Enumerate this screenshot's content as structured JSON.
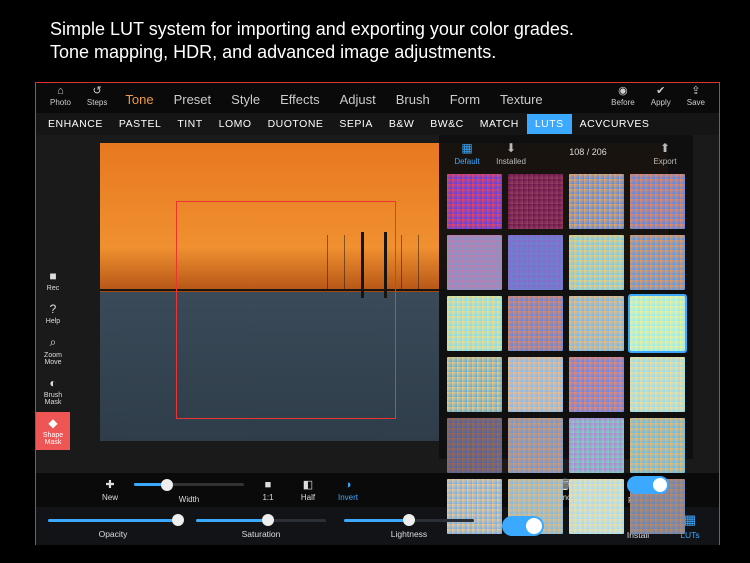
{
  "promo": {
    "line1": "Simple LUT system for importing and exporting your color grades.",
    "line2": "Tone mapping, HDR, and advanced image adjustments."
  },
  "menubar": {
    "photo": "Photo",
    "steps": "Steps",
    "tabs": [
      "Tone",
      "Preset",
      "Style",
      "Effects",
      "Adjust",
      "Brush",
      "Form",
      "Texture"
    ],
    "active_tab": "Tone",
    "before": "Before",
    "apply": "Apply",
    "save": "Save"
  },
  "subtabs": {
    "items": [
      "ENHANCE",
      "PASTEL",
      "TINT",
      "LOMO",
      "DUOTONE",
      "SEPIA",
      "B&W",
      "BW&C",
      "MATCH",
      "LUTS",
      "ACVCURVES"
    ],
    "active": "LUTS"
  },
  "side_tools": [
    {
      "icon": "●",
      "label": "Rec"
    },
    {
      "icon": "?",
      "label": "Help"
    },
    {
      "icon": "⌕",
      "label": "Zoom\nMove"
    },
    {
      "icon": "◐",
      "label": "Brush\nMask"
    },
    {
      "icon": "◆",
      "label": "Shape\nMask",
      "active": true
    }
  ],
  "lut_panel": {
    "default": "Default",
    "installed": "Installed",
    "count": "108 / 206",
    "export": "Export",
    "swatches": [
      "linear-gradient(135deg,#f44,#44f)",
      "linear-gradient(135deg,#614,#946)",
      "linear-gradient(135deg,#fa4,#48f)",
      "linear-gradient(135deg,#f84,#48f)",
      "linear-gradient(135deg,#c7a,#79c)",
      "linear-gradient(135deg,#86c,#68c)",
      "linear-gradient(135deg,#fc6,#6cf)",
      "linear-gradient(135deg,#f94,#49f)",
      "linear-gradient(135deg,#fd7,#7df)",
      "linear-gradient(135deg,#e85,#58e)",
      "linear-gradient(135deg,#fb6,#6bf)",
      "linear-gradient(135deg,#fe8,#8ef)",
      "linear-gradient(135deg,#fc7,#5ad)",
      "linear-gradient(135deg,#fb7,#7bf)",
      "linear-gradient(135deg,#f85,#58f)",
      "linear-gradient(135deg,#fd8,#8df)",
      "linear-gradient(135deg,#a64,#46a)",
      "linear-gradient(135deg,#d96,#69d)",
      "linear-gradient(135deg,#b7d,#7db)",
      "linear-gradient(135deg,#fb5,#5bf)",
      "linear-gradient(135deg,#fc8,#6ae)",
      "linear-gradient(135deg,#eb7,#7be)",
      "linear-gradient(135deg,#fd9,#9df)",
      "linear-gradient(135deg,#c85,#58c)"
    ],
    "selected_index": 11
  },
  "shape_bar": {
    "new": "New",
    "width": "Width",
    "width_value": 30,
    "one_to_one": "1:1",
    "half": "Half",
    "invert": "Invert",
    "remove": "Remove",
    "rectangles": "Rectangles"
  },
  "bottom_bar": {
    "opacity": {
      "label": "Opacity",
      "value": 100
    },
    "saturation": {
      "label": "Saturation",
      "value": 55
    },
    "lightness": {
      "label": "Lightness",
      "value": 50
    },
    "install": "Install",
    "luts": "LUTs"
  }
}
